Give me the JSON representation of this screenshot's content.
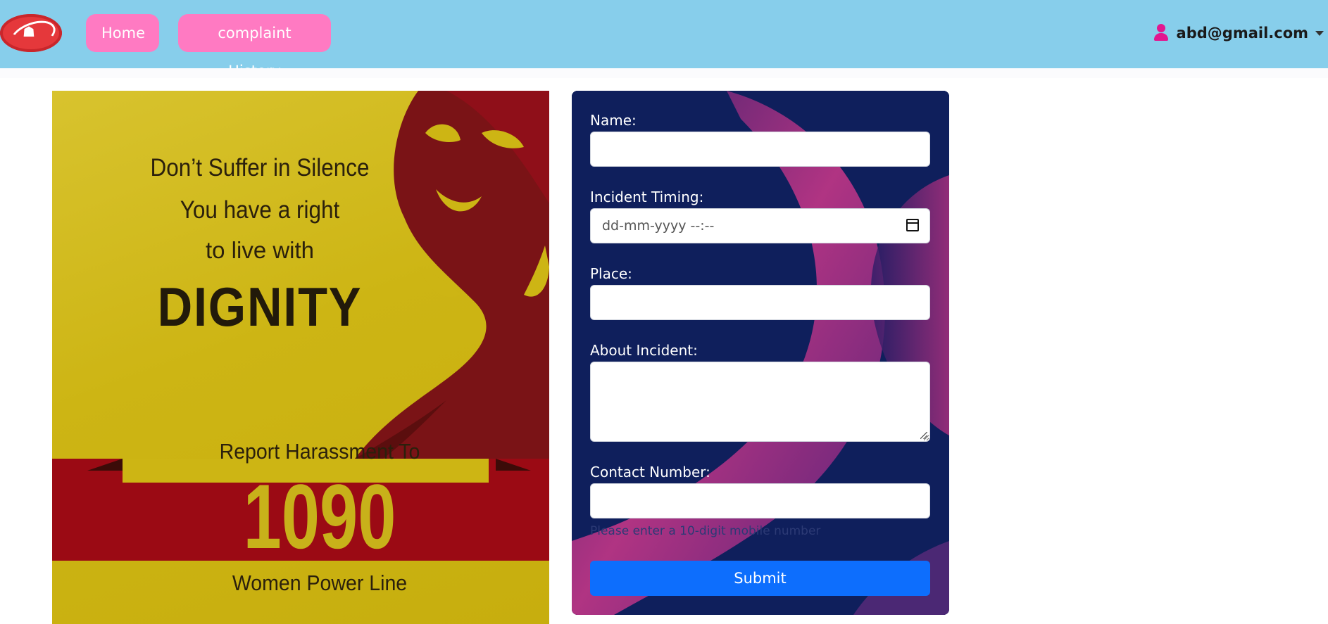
{
  "navbar": {
    "logo_icon": "helping-hands-logo",
    "home_label": "Home",
    "history_label": "complaint History",
    "user_icon": "user-icon",
    "user_email": "abd@gmail.com",
    "nav_bg_color": "#87ceeb",
    "button_color": "#ff7ac2"
  },
  "poster": {
    "line1": "Don’t Suffer in Silence",
    "line2": "You have a right",
    "line3": "to live with",
    "line4": "DIGNITY",
    "line5": "Report Harassment To",
    "number": "1090",
    "line6": "Women Power Line",
    "bg_color": "#cdb514",
    "band_color": "#9b0a14"
  },
  "form": {
    "name_label": "Name:",
    "name_value": "",
    "timing_label": "Incident Timing:",
    "timing_placeholder": "dd-mm-yyyy --:--",
    "place_label": "Place:",
    "place_value": "",
    "about_label": "About Incident:",
    "about_value": "",
    "contact_label": "Contact Number:",
    "contact_value": "",
    "contact_hint": "Please enter a 10-digit mobile number",
    "submit_label": "Submit",
    "card_bg_color": "#0f1f5c",
    "submit_color": "#0d6efd"
  }
}
